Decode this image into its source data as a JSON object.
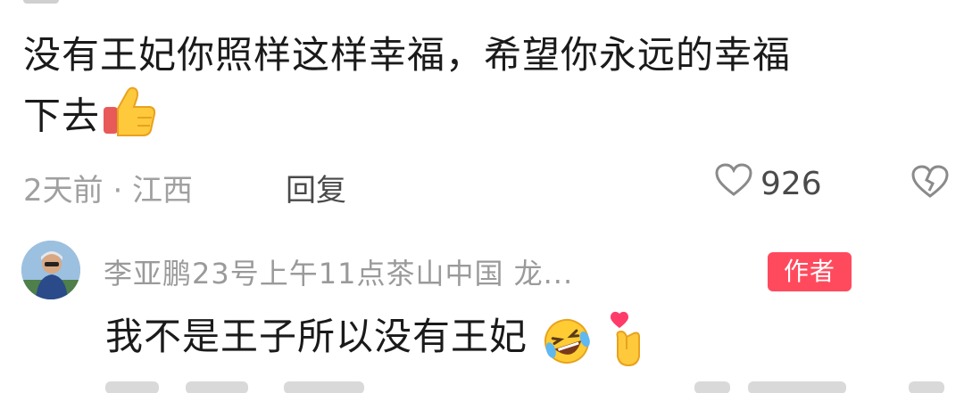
{
  "comment": {
    "line1": "没有王妃你照样这样幸福，希望你永远的幸福",
    "line2": "下去",
    "emoji": "thumbs-up",
    "time_location": "2天前 · 江西",
    "reply_label": "回复",
    "like_count": "926"
  },
  "reply": {
    "author": "李亚鹏23号上午11点茶山中国 龙...",
    "badge": "作者",
    "text": "我不是王子所以没有王妃",
    "emojis": [
      "laughing-crying-face",
      "finger-heart"
    ]
  },
  "colors": {
    "text": "#1a1a1a",
    "meta": "#a0a0a0",
    "badge": "#ff4a5e"
  }
}
